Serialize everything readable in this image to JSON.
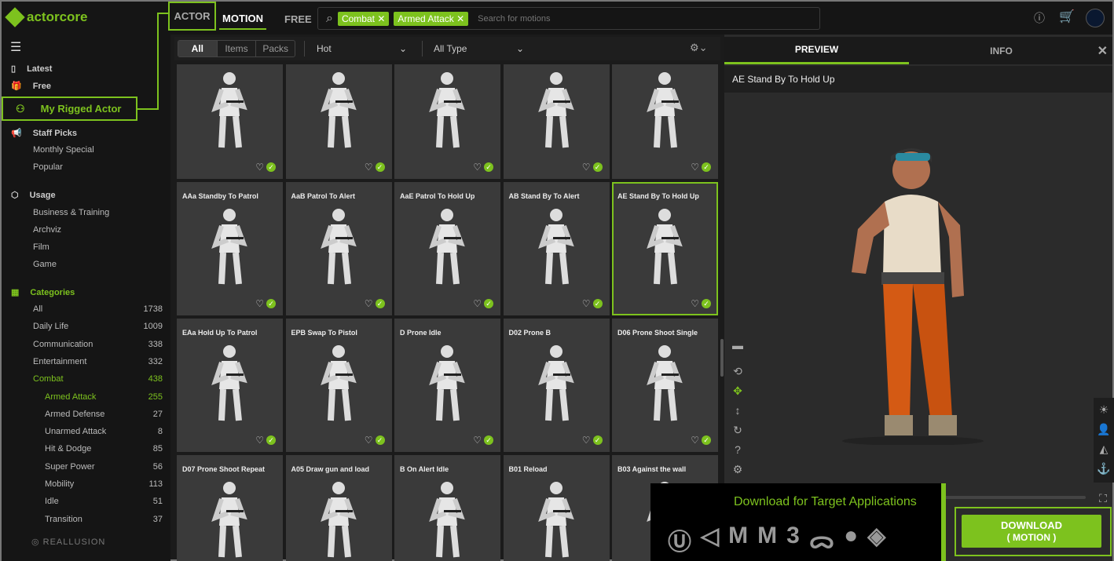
{
  "header": {
    "logo": "actorcore",
    "tabs": [
      "ACTOR",
      "MOTION",
      "FREE"
    ],
    "chips": [
      "Combat",
      "Armed Attack"
    ],
    "search_placeholder": "Search for motions"
  },
  "sidebar": {
    "top": [
      {
        "label": "Latest"
      },
      {
        "label": "Free"
      },
      {
        "label": "My Rigged Actor"
      }
    ],
    "staff": {
      "label": "Staff Picks",
      "items": [
        "Monthly Special",
        "Popular"
      ]
    },
    "usage": {
      "label": "Usage",
      "items": [
        "Business & Training",
        "Archviz",
        "Film",
        "Game"
      ]
    },
    "categories": {
      "label": "Categories",
      "items": [
        {
          "label": "All",
          "count": "1738"
        },
        {
          "label": "Daily Life",
          "count": "1009"
        },
        {
          "label": "Communication",
          "count": "338"
        },
        {
          "label": "Entertainment",
          "count": "332"
        },
        {
          "label": "Combat",
          "count": "438"
        }
      ],
      "sub": [
        {
          "label": "Armed Attack",
          "count": "255"
        },
        {
          "label": "Armed Defense",
          "count": "27"
        },
        {
          "label": "Unarmed Attack",
          "count": "8"
        },
        {
          "label": "Hit & Dodge",
          "count": "85"
        },
        {
          "label": "Super Power",
          "count": "56"
        },
        {
          "label": "Mobility",
          "count": "113"
        },
        {
          "label": "Idle",
          "count": "51"
        },
        {
          "label": "Transition",
          "count": "37"
        }
      ]
    },
    "brand": "REALLUSION"
  },
  "filters": {
    "segments": [
      "All",
      "Items",
      "Packs"
    ],
    "sort": "Hot",
    "type": "All Type"
  },
  "cards": [
    "",
    "",
    "",
    "",
    "",
    "AAa Standby To Patrol",
    "AaB Patrol To Alert",
    "AaE Patrol To Hold Up",
    "AB Stand By To Alert",
    "AE Stand By To Hold Up",
    "EAa Hold Up To Patrol",
    "EPB Swap To Pistol",
    "D Prone Idle",
    "D02 Prone B",
    "D06 Prone Shoot Single",
    "D07 Prone Shoot Repeat",
    "A05 Draw gun and load",
    "B On Alert Idle",
    "B01 Reload",
    "B03 Against the wall"
  ],
  "selected_card": 9,
  "preview": {
    "tabs": [
      "PREVIEW",
      "INFO"
    ],
    "title": "AE Stand By To Hold Up"
  },
  "download": {
    "heading": "Download for Target Applications",
    "button": "DOWNLOAD",
    "sub": "( MOTION )",
    "apps": [
      "unreal",
      "unity",
      "maya",
      "motionbuilder",
      "3ds max",
      "blender",
      "cinema4d",
      "iclone"
    ]
  },
  "colors": {
    "accent": "#7dc21e"
  }
}
